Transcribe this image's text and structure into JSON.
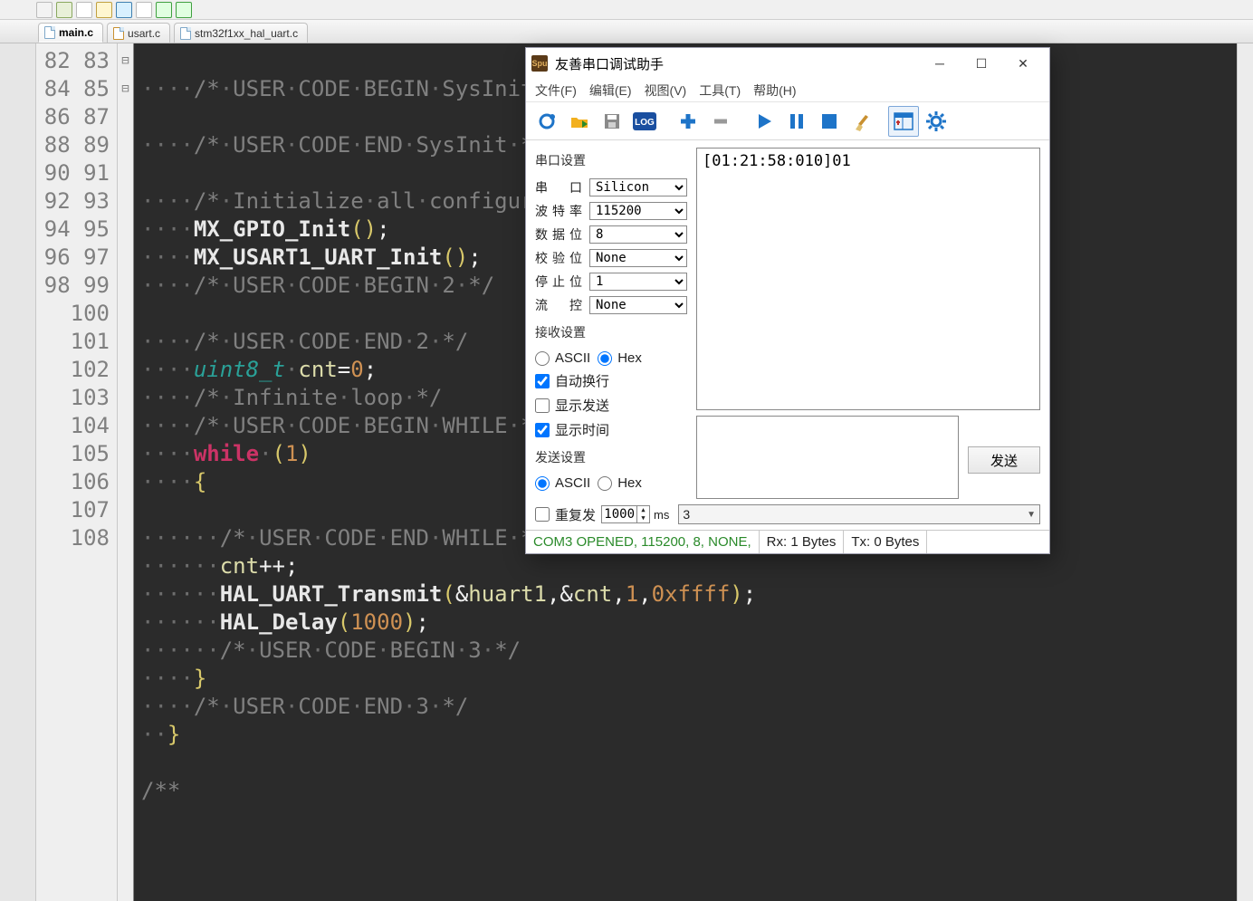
{
  "tabs": [
    {
      "label": "main.c",
      "active": true,
      "class": "main"
    },
    {
      "label": "usart.c",
      "active": false,
      "class": "orange"
    },
    {
      "label": "stm32f1xx_hal_uart.c",
      "active": false,
      "class": ""
    }
  ],
  "gutter": {
    "start": 82,
    "end": 108
  },
  "fold": {
    "97": "⊟",
    "108": "⊟"
  },
  "code": [
    "",
    "····/*·USER·CODE·BEGIN·SysInit·*/",
    "",
    "····/*·USER·CODE·END·SysInit·*/",
    "",
    "····/*·Initialize·all·configured·peripherals·*/",
    "····MX_GPIO_Init();",
    "····MX_USART1_UART_Init();",
    "····/*·USER·CODE·BEGIN·2·*/",
    "",
    "····/*·USER·CODE·END·2·*/",
    "····uint8_t·cnt=0;",
    "····/*·Infinite·loop·*/",
    "····/*·USER·CODE·BEGIN·WHILE·*/",
    "····while·(1)",
    "····{",
    "",
    "······/*·USER·CODE·END·WHILE·*/",
    "······cnt++;",
    "······HAL_UART_Transmit(&huart1,&cnt,1,0xffff);",
    "······HAL_Delay(1000);",
    "······/*·USER·CODE·BEGIN·3·*/",
    "····}",
    "····/*·USER·CODE·END·3·*/",
    "··}",
    "",
    "/**"
  ],
  "tool": {
    "title": "友善串口调试助手",
    "menu": [
      "文件(F)",
      "编辑(E)",
      "视图(V)",
      "工具(T)",
      "帮助(H)"
    ],
    "serial": {
      "group": "串口设置",
      "port": {
        "label": "串   口",
        "value": "Silicon"
      },
      "baud": {
        "label": "波特率",
        "value": "115200"
      },
      "databits": {
        "label": "数据位",
        "value": "8"
      },
      "parity": {
        "label": "校验位",
        "value": "None"
      },
      "stop": {
        "label": "停止位",
        "value": "1"
      },
      "flow": {
        "label": "流   控",
        "value": "None"
      }
    },
    "recv": {
      "group": "接收设置",
      "ascii": "ASCII",
      "hex": "Hex",
      "wrap": "自动换行",
      "showSend": "显示发送",
      "showTime": "显示时间"
    },
    "send": {
      "group": "发送设置",
      "ascii": "ASCII",
      "hex": "Hex",
      "repeat": "重复发",
      "interval": "1000",
      "unit": "ms",
      "btn": "发送"
    },
    "recvText": "[01:21:58:010]01",
    "history": "3",
    "status": {
      "port": "COM3 OPENED, 115200, 8, NONE,",
      "rx": "Rx: 1 Bytes",
      "tx": "Tx: 0 Bytes"
    }
  }
}
